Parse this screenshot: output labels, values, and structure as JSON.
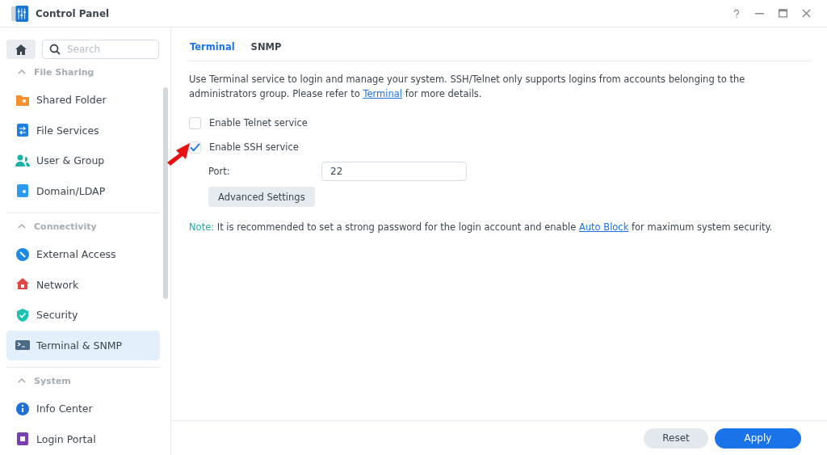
{
  "window": {
    "title": "Control Panel"
  },
  "sidebar": {
    "search": {
      "placeholder": "Search"
    },
    "groups": [
      {
        "heading": "File Sharing",
        "expanded": true,
        "items": [
          {
            "label": "Shared Folder",
            "selected": false
          },
          {
            "label": "File Services",
            "selected": false
          },
          {
            "label": "User & Group",
            "selected": false
          },
          {
            "label": "Domain/LDAP",
            "selected": false
          }
        ]
      },
      {
        "heading": "Connectivity",
        "expanded": true,
        "items": [
          {
            "label": "External Access",
            "selected": false
          },
          {
            "label": "Network",
            "selected": false
          },
          {
            "label": "Security",
            "selected": false
          },
          {
            "label": "Terminal & SNMP",
            "selected": true
          }
        ]
      },
      {
        "heading": "System",
        "expanded": true,
        "items": [
          {
            "label": "Info Center",
            "selected": false
          },
          {
            "label": "Login Portal",
            "selected": false
          }
        ]
      }
    ]
  },
  "tabs": [
    {
      "label": "Terminal",
      "selected": true
    },
    {
      "label": "SNMP",
      "selected": false
    }
  ],
  "intro": {
    "before": "Use Terminal service to login and manage your system. SSH/Telnet only supports logins from accounts belonging to the administrators group. Please refer to",
    "link": "Terminal",
    "after": "for more details."
  },
  "options": [
    {
      "label": "Enable Telnet service",
      "checked": false
    },
    {
      "label": "Enable SSH service",
      "checked": true
    }
  ],
  "port": {
    "label": "Port:",
    "value": "22"
  },
  "advanced_button": "Advanced Settings",
  "note": {
    "label": "Note:",
    "before": "It is recommended to set a strong password for the login account and enable",
    "link": "Auto Block",
    "after": "for maximum system security."
  },
  "footer": {
    "reset": "Reset",
    "apply": "Apply"
  }
}
